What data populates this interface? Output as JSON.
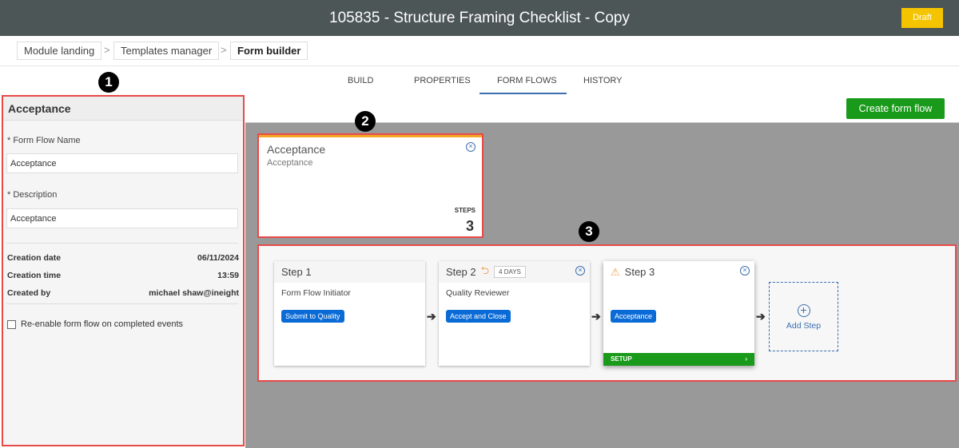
{
  "header": {
    "title": "105835 - Structure Framing Checklist - Copy",
    "status": "Draft"
  },
  "breadcrumb": [
    "Module landing",
    "Templates manager",
    "Form builder"
  ],
  "tabs": [
    "BUILD",
    "PROPERTIES",
    "FORM FLOWS",
    "HISTORY"
  ],
  "toolbar": {
    "create_label": "Create form flow"
  },
  "callouts": [
    "1",
    "2",
    "3"
  ],
  "panel": {
    "title": "Acceptance",
    "name_label": "* Form Flow Name",
    "name_value": "Acceptance",
    "desc_label": "* Description",
    "desc_value": "Acceptance",
    "creation_date_label": "Creation date",
    "creation_date": "06/11/2024",
    "creation_time_label": "Creation time",
    "creation_time": "13:59",
    "created_by_label": "Created by",
    "created_by": "michael shaw@ineight",
    "reenable_label": "Re-enable form flow on completed events"
  },
  "flow_card": {
    "title": "Acceptance",
    "subtitle": "Acceptance",
    "steps_label": "STEPS",
    "steps": "3"
  },
  "steps": [
    {
      "title": "Step 1",
      "role": "Form Flow Initiator",
      "action": "Submit to Quality"
    },
    {
      "title": "Step 2",
      "role": "Quality Reviewer",
      "action": "Accept and Close",
      "duration": "4 DAYS"
    },
    {
      "title": "Step 3",
      "role": "",
      "action": "Acceptance",
      "setup": "SETUP"
    }
  ],
  "add_step": "Add Step",
  "colors": {
    "accent": "#1a9a1a",
    "badge": "#0a6bd6",
    "highlight": "#e84a4a"
  }
}
